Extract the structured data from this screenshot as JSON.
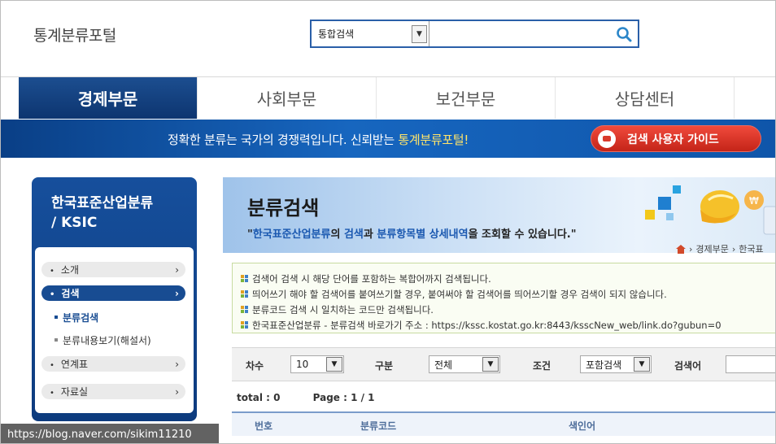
{
  "header": {
    "logo": "통계분류포털",
    "search_scope": "통합검색",
    "search_value": ""
  },
  "gnb": [
    "경제부문",
    "사회부문",
    "보건부문",
    "상담센터"
  ],
  "banner": {
    "text_pre": "정확한 분류는 국가의 경쟁력입니다. 신뢰받는 ",
    "text_highlight": "통계분류포털!",
    "guide_button": "검색 사용자 가이드"
  },
  "lnb": {
    "title_line1": "한국표준산업분류",
    "title_line2": "/ KSIC",
    "menu": {
      "intro": "소개",
      "search": "검색",
      "sub_search": "분류검색",
      "sub_explain": "분류내용보기(해설서)",
      "link": "연계표",
      "data": "자료실"
    }
  },
  "content": {
    "title": "분류검색",
    "desc_quote_open": "\"",
    "desc_b1": "한국표준산업분류",
    "desc_t1": "의 ",
    "desc_b2": "검색",
    "desc_t2": "과 ",
    "desc_b3": "분류항목별 상세내역",
    "desc_t3": "을 조회할 수 있습니다.\"",
    "breadcrumb_1": "경제부문",
    "breadcrumb_2": "한국표",
    "notices": [
      "검색어 검색 시 해당 단어를 포함하는 복합어까지 검색됩니다.",
      "띄어쓰기 해야 할 검색어를 붙여쓰기할 경우, 붙여써야 할 검색어를 띄어쓰기할 경우 검색이 되지 않습니다.",
      "분류코드 검색 시 일치하는 코드만 검색됩니다.",
      "한국표준산업분류 - 분류검색 바로가기 주소 : https://kssc.kostat.go.kr:8443/ksscNew_web/link.do?gubun=0"
    ]
  },
  "filters": {
    "order_label": "차수",
    "order_value": "10",
    "type_label": "구분",
    "type_value": "전체",
    "cond_label": "조건",
    "cond_value": "포함검색",
    "keyword_label": "검색어",
    "keyword_value": ""
  },
  "results": {
    "total": "total : 0",
    "page": "Page : 1 / 1"
  },
  "table": {
    "headers": [
      "번호",
      "분류코드",
      "색인어"
    ]
  },
  "watermark": "https://blog.naver.com/sikim11210",
  "colors": {
    "brand_blue": "#184c92",
    "banner_blue": "#1766bf",
    "guide_red": "#d93a2c"
  }
}
